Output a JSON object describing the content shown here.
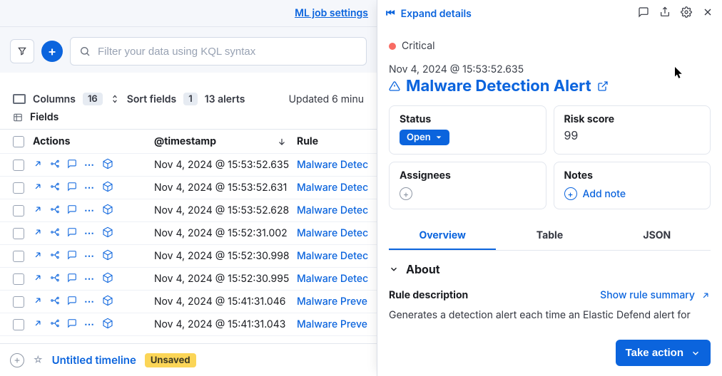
{
  "left": {
    "header_link": "ML job settings",
    "kql_placeholder": "Filter your data using KQL syntax",
    "columns_label": "Columns",
    "columns_count": "16",
    "sort_label": "Sort fields",
    "sort_count": "1",
    "alerts_count": "13 alerts",
    "updated": "Updated 6 minu",
    "fields_label": "Fields",
    "head_actions": "Actions",
    "head_timestamp": "@timestamp",
    "head_rule": "Rule",
    "rows": [
      {
        "ts": "Nov 4, 2024 @ 15:53:52.635",
        "rule": "Malware Detec"
      },
      {
        "ts": "Nov 4, 2024 @ 15:53:52.631",
        "rule": "Malware Detec"
      },
      {
        "ts": "Nov 4, 2024 @ 15:53:52.628",
        "rule": "Malware Detec"
      },
      {
        "ts": "Nov 4, 2024 @ 15:52:31.002",
        "rule": "Malware Detec"
      },
      {
        "ts": "Nov 4, 2024 @ 15:52:30.998",
        "rule": "Malware Detec"
      },
      {
        "ts": "Nov 4, 2024 @ 15:52:30.995",
        "rule": "Malware Detec"
      },
      {
        "ts": "Nov 4, 2024 @ 15:41:31.046",
        "rule": "Malware Preve"
      },
      {
        "ts": "Nov 4, 2024 @ 15:41:31.043",
        "rule": "Malware Preve"
      }
    ],
    "timeline_label": "Untitled timeline",
    "unsaved": "Unsaved"
  },
  "flyout": {
    "expand_label": "Expand details",
    "severity": "Critical",
    "timestamp": "Nov 4, 2024 @ 15:53:52.635",
    "title": "Malware Detection Alert",
    "status_label": "Status",
    "status_value": "Open",
    "risk_label": "Risk score",
    "risk_value": "99",
    "assignees_label": "Assignees",
    "notes_label": "Notes",
    "add_note": "Add note",
    "tabs": {
      "overview": "Overview",
      "table": "Table",
      "json": "JSON"
    },
    "about": "About",
    "rule_desc_label": "Rule description",
    "show_summary": "Show rule summary",
    "description": "Generates a detection alert each time an Elastic Defend alert for",
    "take_action": "Take action"
  }
}
